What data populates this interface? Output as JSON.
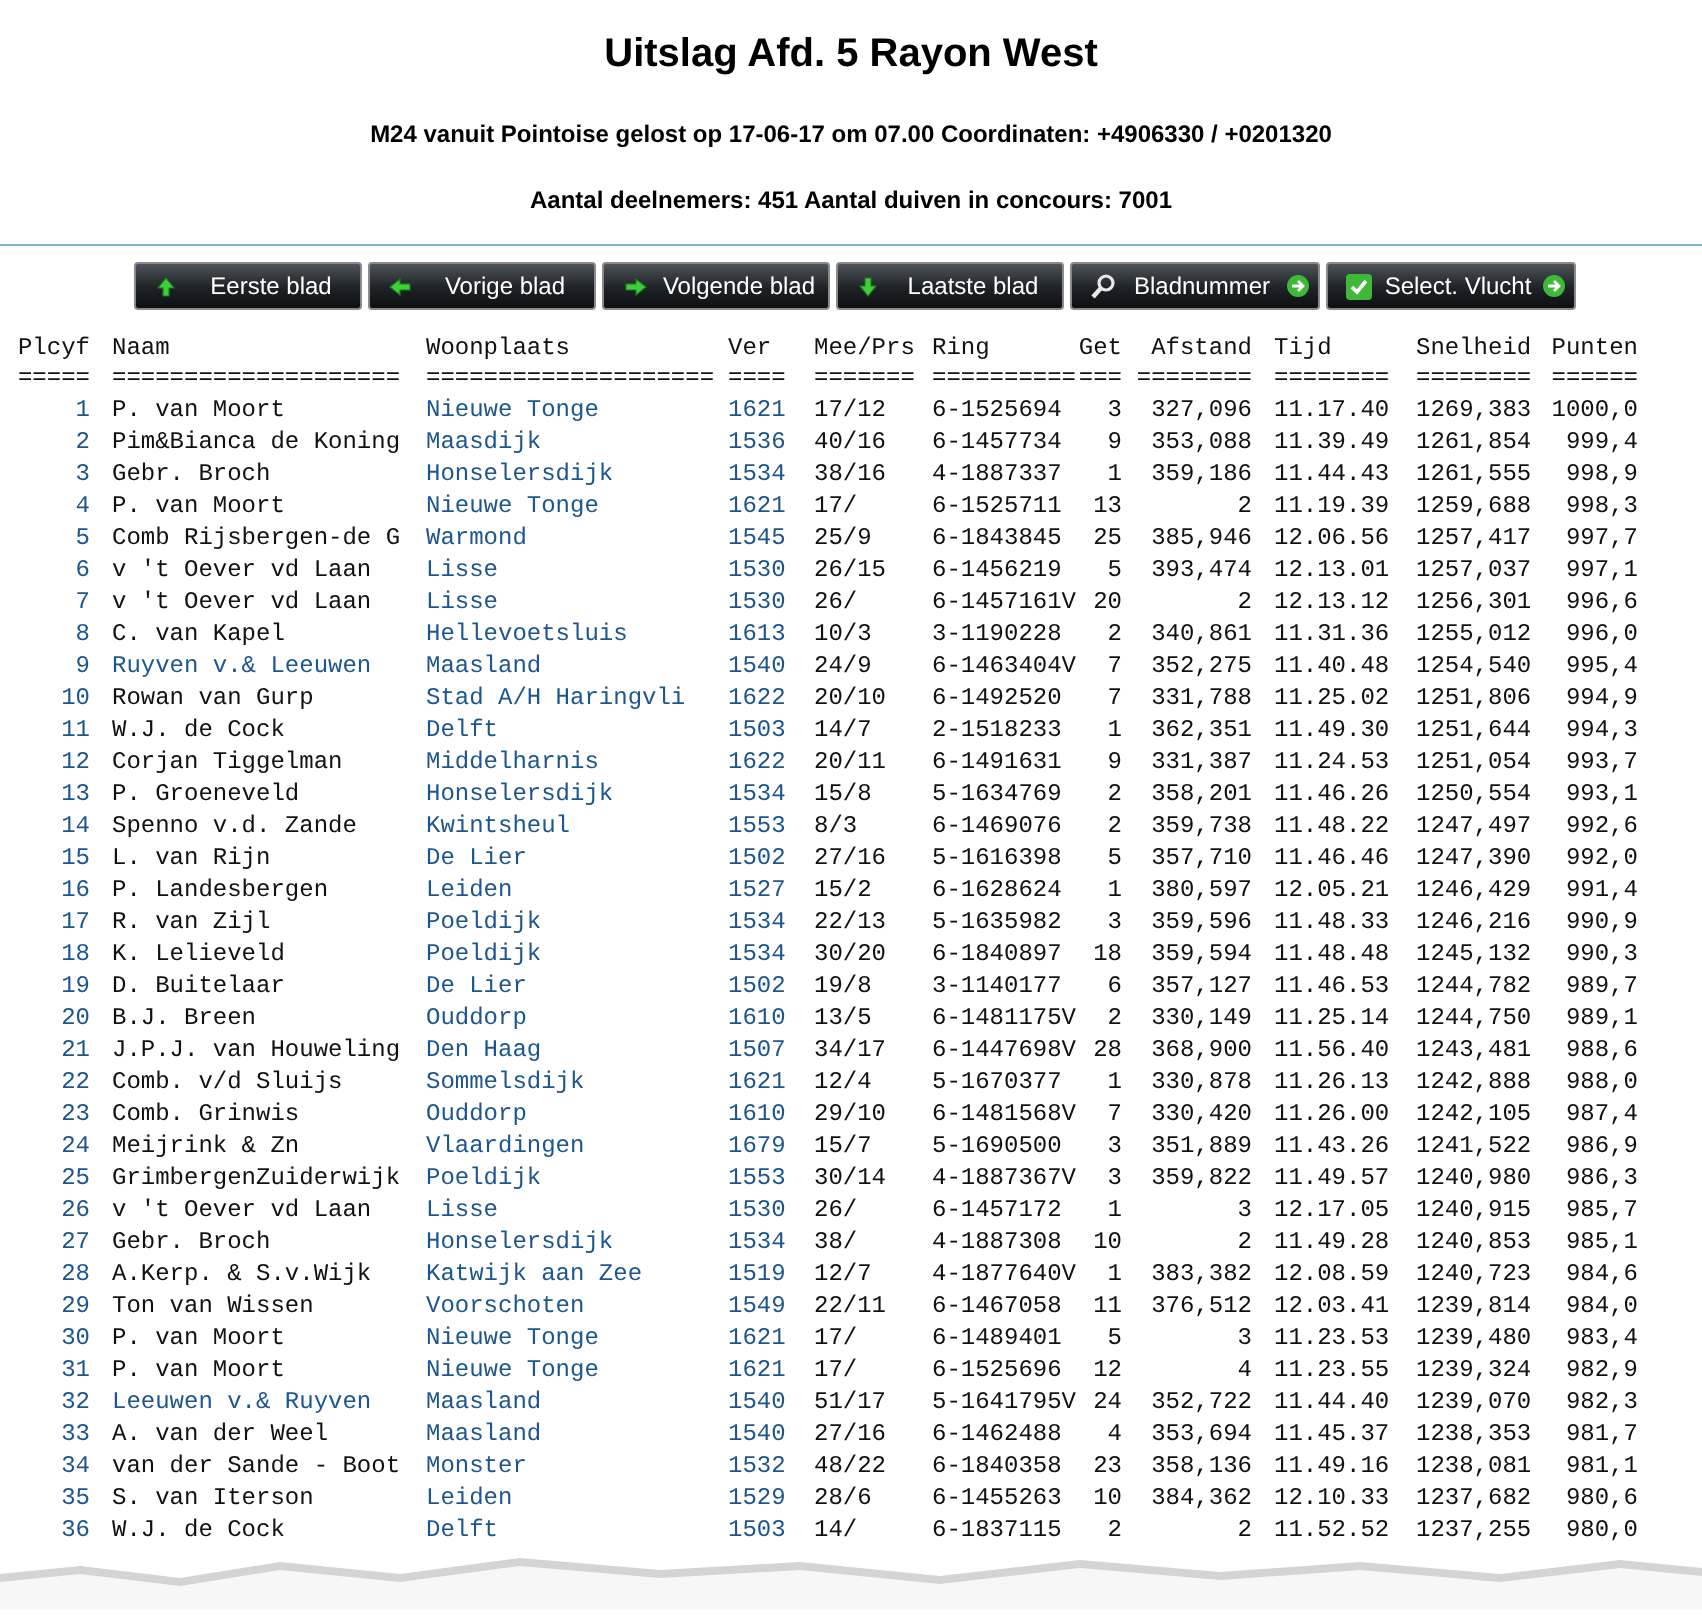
{
  "title": "Uitslag Afd. 5 Rayon West",
  "subtitle": "M24 vanuit Pointoise gelost op 17-06-17 om 07.00 Coordinaten: +4906330 / +0201320",
  "summary": "Aantal deelnemers: 451 Aantal duiven in concours: 7001",
  "buttons": [
    {
      "label": "Eerste blad",
      "kind": "up",
      "trailing_arrow": false
    },
    {
      "label": "Vorige blad",
      "kind": "left",
      "trailing_arrow": false
    },
    {
      "label": "Volgende blad",
      "kind": "right",
      "trailing_arrow": false
    },
    {
      "label": "Laatste blad",
      "kind": "down",
      "trailing_arrow": false
    },
    {
      "label": "Bladnummer",
      "kind": "search",
      "trailing_arrow": true
    },
    {
      "label": "Select. Vlucht",
      "kind": "check",
      "trailing_arrow": true
    }
  ],
  "columns": [
    {
      "label": "Plcyf",
      "rule": "====="
    },
    {
      "label": "Naam",
      "rule": "===================="
    },
    {
      "label": "Woonplaats",
      "rule": "===================="
    },
    {
      "label": "Ver",
      "rule": "===="
    },
    {
      "label": "Mee/Prs",
      "rule": "======="
    },
    {
      "label": "Ring",
      "rule": "=========="
    },
    {
      "label": "Get",
      "rule": "==="
    },
    {
      "label": "Afstand",
      "rule": "========"
    },
    {
      "label": "Tijd",
      "rule": "========"
    },
    {
      "label": "Snelheid",
      "rule": "========"
    },
    {
      "label": "Punten",
      "rule": "======"
    }
  ],
  "rows": [
    {
      "highlighted": false,
      "cells": [
        "1",
        "P. van Moort",
        "Nieuwe Tonge",
        "1621",
        "17/12",
        "6-1525694",
        "3",
        "327,096",
        "11.17.40",
        "1269,383",
        "1000,0"
      ]
    },
    {
      "highlighted": false,
      "cells": [
        "2",
        "Pim&Bianca de Koning",
        "Maasdijk",
        "1536",
        "40/16",
        "6-1457734",
        "9",
        "353,088",
        "11.39.49",
        "1261,854",
        "999,4"
      ]
    },
    {
      "highlighted": false,
      "cells": [
        "3",
        "Gebr. Broch",
        "Honselersdijk",
        "1534",
        "38/16",
        "4-1887337",
        "1",
        "359,186",
        "11.44.43",
        "1261,555",
        "998,9"
      ]
    },
    {
      "highlighted": false,
      "cells": [
        "4",
        "P. van Moort",
        "Nieuwe Tonge",
        "1621",
        "17/",
        "6-1525711",
        "13",
        "2",
        "11.19.39",
        "1259,688",
        "998,3"
      ]
    },
    {
      "highlighted": false,
      "cells": [
        "5",
        "Comb Rijsbergen-de G",
        "Warmond",
        "1545",
        "25/9",
        "6-1843845",
        "25",
        "385,946",
        "12.06.56",
        "1257,417",
        "997,7"
      ]
    },
    {
      "highlighted": false,
      "cells": [
        "6",
        "v 't Oever vd Laan",
        "Lisse",
        "1530",
        "26/15",
        "6-1456219",
        "5",
        "393,474",
        "12.13.01",
        "1257,037",
        "997,1"
      ]
    },
    {
      "highlighted": false,
      "cells": [
        "7",
        "v 't Oever vd Laan",
        "Lisse",
        "1530",
        "26/",
        "6-1457161V",
        "20",
        "2",
        "12.13.12",
        "1256,301",
        "996,6"
      ]
    },
    {
      "highlighted": false,
      "cells": [
        "8",
        "C. van Kapel",
        "Hellevoetsluis",
        "1613",
        "10/3",
        "3-1190228",
        "2",
        "340,861",
        "11.31.36",
        "1255,012",
        "996,0"
      ]
    },
    {
      "highlighted": true,
      "cells": [
        "9",
        "Ruyven v.& Leeuwen",
        "Maasland",
        "1540",
        "24/9",
        "6-1463404V",
        "7",
        "352,275",
        "11.40.48",
        "1254,540",
        "995,4"
      ]
    },
    {
      "highlighted": false,
      "cells": [
        "10",
        "Rowan van Gurp",
        "Stad A/H Haringvli",
        "1622",
        "20/10",
        "6-1492520",
        "7",
        "331,788",
        "11.25.02",
        "1251,806",
        "994,9"
      ]
    },
    {
      "highlighted": false,
      "cells": [
        "11",
        "W.J. de Cock",
        "Delft",
        "1503",
        "14/7",
        "2-1518233",
        "1",
        "362,351",
        "11.49.30",
        "1251,644",
        "994,3"
      ]
    },
    {
      "highlighted": false,
      "cells": [
        "12",
        "Corjan Tiggelman",
        "Middelharnis",
        "1622",
        "20/11",
        "6-1491631",
        "9",
        "331,387",
        "11.24.53",
        "1251,054",
        "993,7"
      ]
    },
    {
      "highlighted": false,
      "cells": [
        "13",
        "P. Groeneveld",
        "Honselersdijk",
        "1534",
        "15/8",
        "5-1634769",
        "2",
        "358,201",
        "11.46.26",
        "1250,554",
        "993,1"
      ]
    },
    {
      "highlighted": false,
      "cells": [
        "14",
        "Spenno v.d. Zande",
        "Kwintsheul",
        "1553",
        "8/3",
        "6-1469076",
        "2",
        "359,738",
        "11.48.22",
        "1247,497",
        "992,6"
      ]
    },
    {
      "highlighted": false,
      "cells": [
        "15",
        "L. van Rijn",
        "De Lier",
        "1502",
        "27/16",
        "5-1616398",
        "5",
        "357,710",
        "11.46.46",
        "1247,390",
        "992,0"
      ]
    },
    {
      "highlighted": false,
      "cells": [
        "16",
        "P. Landesbergen",
        "Leiden",
        "1527",
        "15/2",
        "6-1628624",
        "1",
        "380,597",
        "12.05.21",
        "1246,429",
        "991,4"
      ]
    },
    {
      "highlighted": false,
      "cells": [
        "17",
        "R. van Zijl",
        "Poeldijk",
        "1534",
        "22/13",
        "5-1635982",
        "3",
        "359,596",
        "11.48.33",
        "1246,216",
        "990,9"
      ]
    },
    {
      "highlighted": false,
      "cells": [
        "18",
        "K. Lelieveld",
        "Poeldijk",
        "1534",
        "30/20",
        "6-1840897",
        "18",
        "359,594",
        "11.48.48",
        "1245,132",
        "990,3"
      ]
    },
    {
      "highlighted": false,
      "cells": [
        "19",
        "D. Buitelaar",
        "De Lier",
        "1502",
        "19/8",
        "3-1140177",
        "6",
        "357,127",
        "11.46.53",
        "1244,782",
        "989,7"
      ]
    },
    {
      "highlighted": false,
      "cells": [
        "20",
        "B.J. Breen",
        "Ouddorp",
        "1610",
        "13/5",
        "6-1481175V",
        "2",
        "330,149",
        "11.25.14",
        "1244,750",
        "989,1"
      ]
    },
    {
      "highlighted": false,
      "cells": [
        "21",
        "J.P.J. van Houweling",
        "Den Haag",
        "1507",
        "34/17",
        "6-1447698V",
        "28",
        "368,900",
        "11.56.40",
        "1243,481",
        "988,6"
      ]
    },
    {
      "highlighted": false,
      "cells": [
        "22",
        "Comb. v/d Sluijs",
        "Sommelsdijk",
        "1621",
        "12/4",
        "5-1670377",
        "1",
        "330,878",
        "11.26.13",
        "1242,888",
        "988,0"
      ]
    },
    {
      "highlighted": false,
      "cells": [
        "23",
        "Comb. Grinwis",
        "Ouddorp",
        "1610",
        "29/10",
        "6-1481568V",
        "7",
        "330,420",
        "11.26.00",
        "1242,105",
        "987,4"
      ]
    },
    {
      "highlighted": false,
      "cells": [
        "24",
        "Meijrink & Zn",
        "Vlaardingen",
        "1679",
        "15/7",
        "5-1690500",
        "3",
        "351,889",
        "11.43.26",
        "1241,522",
        "986,9"
      ]
    },
    {
      "highlighted": false,
      "cells": [
        "25",
        "GrimbergenZuiderwijk",
        "Poeldijk",
        "1553",
        "30/14",
        "4-1887367V",
        "3",
        "359,822",
        "11.49.57",
        "1240,980",
        "986,3"
      ]
    },
    {
      "highlighted": false,
      "cells": [
        "26",
        "v 't Oever vd Laan",
        "Lisse",
        "1530",
        "26/",
        "6-1457172",
        "1",
        "3",
        "12.17.05",
        "1240,915",
        "985,7"
      ]
    },
    {
      "highlighted": false,
      "cells": [
        "27",
        "Gebr. Broch",
        "Honselersdijk",
        "1534",
        "38/",
        "4-1887308",
        "10",
        "2",
        "11.49.28",
        "1240,853",
        "985,1"
      ]
    },
    {
      "highlighted": false,
      "cells": [
        "28",
        "A.Kerp. & S.v.Wijk",
        "Katwijk aan Zee",
        "1519",
        "12/7",
        "4-1877640V",
        "1",
        "383,382",
        "12.08.59",
        "1240,723",
        "984,6"
      ]
    },
    {
      "highlighted": false,
      "cells": [
        "29",
        "Ton van Wissen",
        "Voorschoten",
        "1549",
        "22/11",
        "6-1467058",
        "11",
        "376,512",
        "12.03.41",
        "1239,814",
        "984,0"
      ]
    },
    {
      "highlighted": false,
      "cells": [
        "30",
        "P. van Moort",
        "Nieuwe Tonge",
        "1621",
        "17/",
        "6-1489401",
        "5",
        "3",
        "11.23.53",
        "1239,480",
        "983,4"
      ]
    },
    {
      "highlighted": false,
      "cells": [
        "31",
        "P. van Moort",
        "Nieuwe Tonge",
        "1621",
        "17/",
        "6-1525696",
        "12",
        "4",
        "11.23.55",
        "1239,324",
        "982,9"
      ]
    },
    {
      "highlighted": true,
      "cells": [
        "32",
        "Leeuwen v.& Ruyven",
        "Maasland",
        "1540",
        "51/17",
        "5-1641795V",
        "24",
        "352,722",
        "11.44.40",
        "1239,070",
        "982,3"
      ]
    },
    {
      "highlighted": false,
      "cells": [
        "33",
        "A. van der Weel",
        "Maasland",
        "1540",
        "27/16",
        "6-1462488",
        "4",
        "353,694",
        "11.45.37",
        "1238,353",
        "981,7"
      ]
    },
    {
      "highlighted": false,
      "cells": [
        "34",
        "van der Sande - Boot",
        "Monster",
        "1532",
        "48/22",
        "6-1840358",
        "23",
        "358,136",
        "11.49.16",
        "1238,081",
        "981,1"
      ]
    },
    {
      "highlighted": false,
      "cells": [
        "35",
        "S. van Iterson",
        "Leiden",
        "1529",
        "28/6",
        "6-1455263",
        "10",
        "384,362",
        "12.10.33",
        "1237,682",
        "980,6"
      ]
    },
    {
      "highlighted": false,
      "cells": [
        "36",
        "W.J. de Cock",
        "Delft",
        "1503",
        "14/",
        "6-1837115",
        "2",
        "2",
        "11.52.52",
        "1237,255",
        "980,0"
      ]
    }
  ]
}
